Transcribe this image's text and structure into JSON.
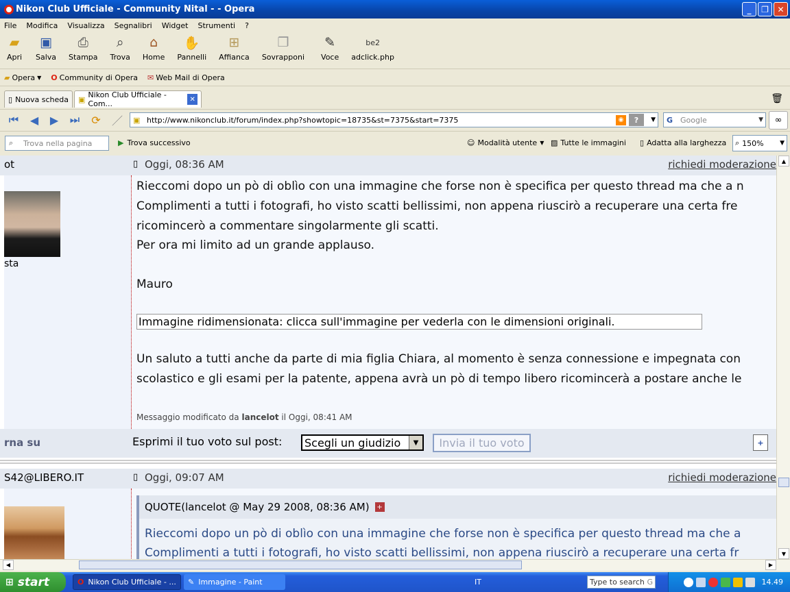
{
  "window": {
    "title": "Nikon Club Ufficiale - Community Nital - - Opera"
  },
  "menu": [
    "File",
    "Modifica",
    "Visualizza",
    "Segnalibri",
    "Widget",
    "Strumenti",
    "?"
  ],
  "toolbar": [
    {
      "label": "Apri",
      "icon": "folder-icon"
    },
    {
      "label": "Salva",
      "icon": "save-icon"
    },
    {
      "label": "Stampa",
      "icon": "print-icon"
    },
    {
      "label": "Trova",
      "icon": "find-icon"
    },
    {
      "label": "Home",
      "icon": "home-icon"
    },
    {
      "label": "Pannelli",
      "icon": "panels-icon"
    },
    {
      "label": "Affianca",
      "icon": "tile-icon"
    },
    {
      "label": "Sovrapponi",
      "icon": "cascade-icon"
    },
    {
      "label": "Voce",
      "icon": "voice-icon"
    },
    {
      "label": "adclick.php",
      "icon": "adclick-icon"
    }
  ],
  "bookmarks": [
    "Opera",
    "Community di Opera",
    "Web Mail di Opera"
  ],
  "tabs": [
    {
      "label": "Nuova scheda"
    },
    {
      "label": "Nikon Club Ufficiale - Com..."
    }
  ],
  "address": {
    "url": "http://www.nikonclub.it/forum/index.php?showtopic=18735&st=7375&start=7375",
    "search_placeholder": "Google"
  },
  "findbar": {
    "placeholder": "Trova nella pagina",
    "next": "Trova successivo",
    "user_mode": "Modalità utente",
    "all_images": "Tutte le immagini",
    "fit_width": "Adatta alla larghezza",
    "zoom": "150%"
  },
  "post1": {
    "author": "ot",
    "rank": "sta",
    "date": "Oggi, 08:36 AM",
    "moderation": "richiedi moderazione",
    "lines": [
      "Rieccomi dopo un pò di oblìo con una immagine che forse non è specifica per questo thread  ma che a n",
      "Complimenti a tutti i fotografi, ho visto scatti bellissimi, non appena riuscirò a recuperare una certa fre",
      "ricomincerò a commentare singolarmente gli scatti.",
      "Per ora mi limito ad un grande applauso."
    ],
    "signature": "Mauro",
    "resize_notice": "Immagine ridimensionata: clicca sull'immagine per vederla con le dimensioni originali.",
    "lines2": [
      "Un saluto a tutti anche da parte di mia figlia Chiara, al momento è senza connessione e impegnata con",
      "scolastico e gli esami per la patente, appena avrà un pò di tempo libero ricomincerà a postare anche le"
    ],
    "edited_prefix": "Messaggio modificato da",
    "edited_by": "lancelot",
    "edited_suffix": "il Oggi, 08:41 AM",
    "back_to_top": "rna su",
    "vote_label": "Esprimi il tuo voto sul post:",
    "vote_select": "Scegli un giudizio",
    "vote_button": "Invia il tuo voto"
  },
  "post2": {
    "author": "S42@LIBERO.IT",
    "date": "Oggi, 09:07 AM",
    "moderation": "richiedi moderazione",
    "quote_header": "QUOTE(lancelot @ May 29 2008, 08:36 AM)",
    "quote_lines": [
      "Rieccomi dopo un pò di oblìo con una immagine che forse non è specifica per questo thread  ma che a",
      "Complimenti a tutti i fotografi, ho visto scatti bellissimi, non appena riuscirò a recuperare una certa fr"
    ]
  },
  "taskbar": {
    "start": "start",
    "tasks": [
      "Nikon Club Ufficiale - ...",
      "Immagine - Paint"
    ],
    "lang": "IT",
    "search": "Type to search",
    "clock": "14.49"
  },
  "colors": {
    "titlebar": "#0844a8",
    "quote_text": "#2b4a86"
  }
}
